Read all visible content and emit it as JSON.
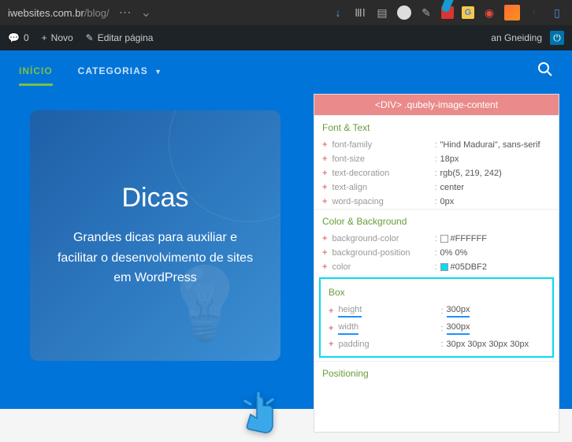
{
  "browser": {
    "url_domain": "iwebsites.com.br",
    "url_path": "/blog/"
  },
  "wpbar": {
    "comment_count": "0",
    "novo": "Novo",
    "editar": "Editar página",
    "user": "an Gneiding"
  },
  "nav": {
    "inicio": "INÍCIO",
    "categorias": "CATEGORIAS"
  },
  "card": {
    "title": "Dicas",
    "desc": "Grandes dicas para auxiliar e facilitar o desenvolvimento de sites em WordPress"
  },
  "devtools": {
    "selector": "<DIV> .qubely-image-content",
    "sections": {
      "font": {
        "title": "Font & Text",
        "props": [
          {
            "name": "font-family",
            "value": "\"Hind Madurai\", sans-serif"
          },
          {
            "name": "font-size",
            "value": "18px"
          },
          {
            "name": "text-decoration",
            "value": "rgb(5, 219, 242)"
          },
          {
            "name": "text-align",
            "value": "center"
          },
          {
            "name": "word-spacing",
            "value": "0px"
          }
        ]
      },
      "color": {
        "title": "Color & Background",
        "props": [
          {
            "name": "background-color",
            "value": "#FFFFFF",
            "swatch": "#FFFFFF"
          },
          {
            "name": "background-position",
            "value": "0% 0%"
          },
          {
            "name": "color",
            "value": "#05DBF2",
            "swatch": "#05DBF2"
          }
        ]
      },
      "box": {
        "title": "Box",
        "props": [
          {
            "name": "height",
            "value": "300px",
            "underline": true
          },
          {
            "name": "width",
            "value": "300px",
            "underline": true
          },
          {
            "name": "padding",
            "value": "30px 30px 30px 30px"
          }
        ]
      },
      "positioning": {
        "title": "Positioning"
      }
    }
  }
}
